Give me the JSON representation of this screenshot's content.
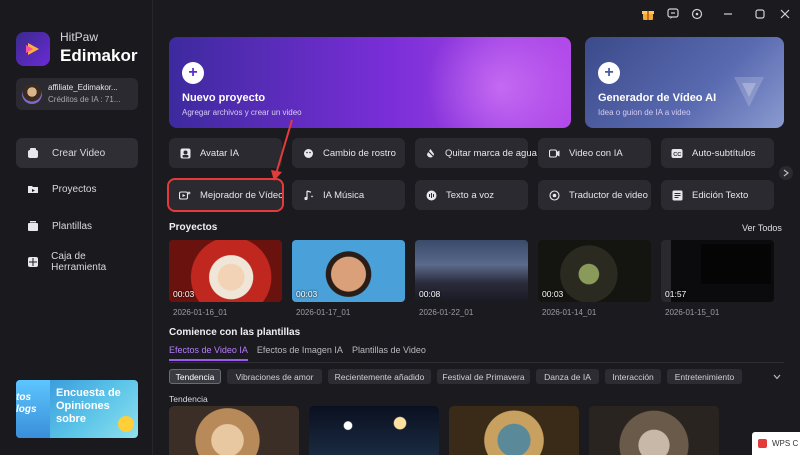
{
  "app": {
    "brand_line1": "HitPaw",
    "brand_line2": "Edimakor"
  },
  "account": {
    "name": "affiliate_Edimakor...",
    "credits": "Créditos de IA : 71..."
  },
  "sidebar": {
    "items": [
      {
        "label": "Crear Video",
        "icon": "create-video-icon",
        "active": true
      },
      {
        "label": "Proyectos",
        "icon": "folder-icon"
      },
      {
        "label": "Plantillas",
        "icon": "template-icon"
      },
      {
        "label": "Caja de Herramienta",
        "icon": "toolbox-icon"
      }
    ],
    "promo": {
      "left_text": "tos\nlogs",
      "text": "Encuesta de\nOpiniones\nsobre"
    }
  },
  "titlebar": {
    "icons": [
      "gift-icon",
      "chat-icon",
      "settings-icon",
      "minimize-icon",
      "maximize-icon",
      "close-icon"
    ]
  },
  "banners": {
    "new_project": {
      "title": "Nuevo proyecto",
      "subtitle": "Agregar archivos y crear un video"
    },
    "ai_video": {
      "title": "Generador de Vídeo AI",
      "subtitle": "Idea o guion de IA a video"
    }
  },
  "tools": {
    "row1": [
      {
        "label": "Avatar IA",
        "icon": "avatar-icon"
      },
      {
        "label": "Cambio de rostro",
        "icon": "face-swap-icon"
      },
      {
        "label": "Quitar marca de agua",
        "icon": "watermark-remove-icon"
      },
      {
        "label": "Video con IA",
        "icon": "ai-video-icon"
      },
      {
        "label": "Auto-subtítulos",
        "icon": "subtitles-icon"
      }
    ],
    "row2": [
      {
        "label": "Mejorador de Vídeo",
        "icon": "enhance-video-icon",
        "highlighted": true
      },
      {
        "label": "IA Música",
        "icon": "music-icon"
      },
      {
        "label": "Texto a voz",
        "icon": "text-to-speech-icon"
      },
      {
        "label": "Traductor de video",
        "icon": "translate-icon"
      },
      {
        "label": "Edición Texto",
        "icon": "text-edit-icon"
      }
    ]
  },
  "projects": {
    "title": "Proyectos",
    "see_all": "Ver Todos",
    "items": [
      {
        "duration": "00:03",
        "name": "2026-01-16_01"
      },
      {
        "duration": "00:03",
        "name": "2026-01-17_01"
      },
      {
        "duration": "00:08",
        "name": "2026-01-22_01"
      },
      {
        "duration": "00:03",
        "name": "2026-01-14_01"
      },
      {
        "duration": "01:57",
        "name": "2026-01-15_01"
      }
    ]
  },
  "templates": {
    "title": "Comience con las plantillas",
    "tabs": [
      {
        "label": "Efectos de Video IA",
        "active": true
      },
      {
        "label": "Efectos de Imagen IA"
      },
      {
        "label": "Plantillas de Video"
      }
    ],
    "chips": [
      {
        "label": "Tendencia",
        "active": true
      },
      {
        "label": "Vibraciones de amor"
      },
      {
        "label": "Recientemente añadido"
      },
      {
        "label": "Festival de Primavera"
      },
      {
        "label": "Danza de IA"
      },
      {
        "label": "Interacción"
      },
      {
        "label": "Entretenimiento"
      }
    ],
    "section_label": "Tendencia"
  },
  "overlay": {
    "wps_label": "WPS C"
  },
  "colors": {
    "accent": "#9a5cf0",
    "highlight": "#e23b3b",
    "background": "#1b1b1f"
  }
}
